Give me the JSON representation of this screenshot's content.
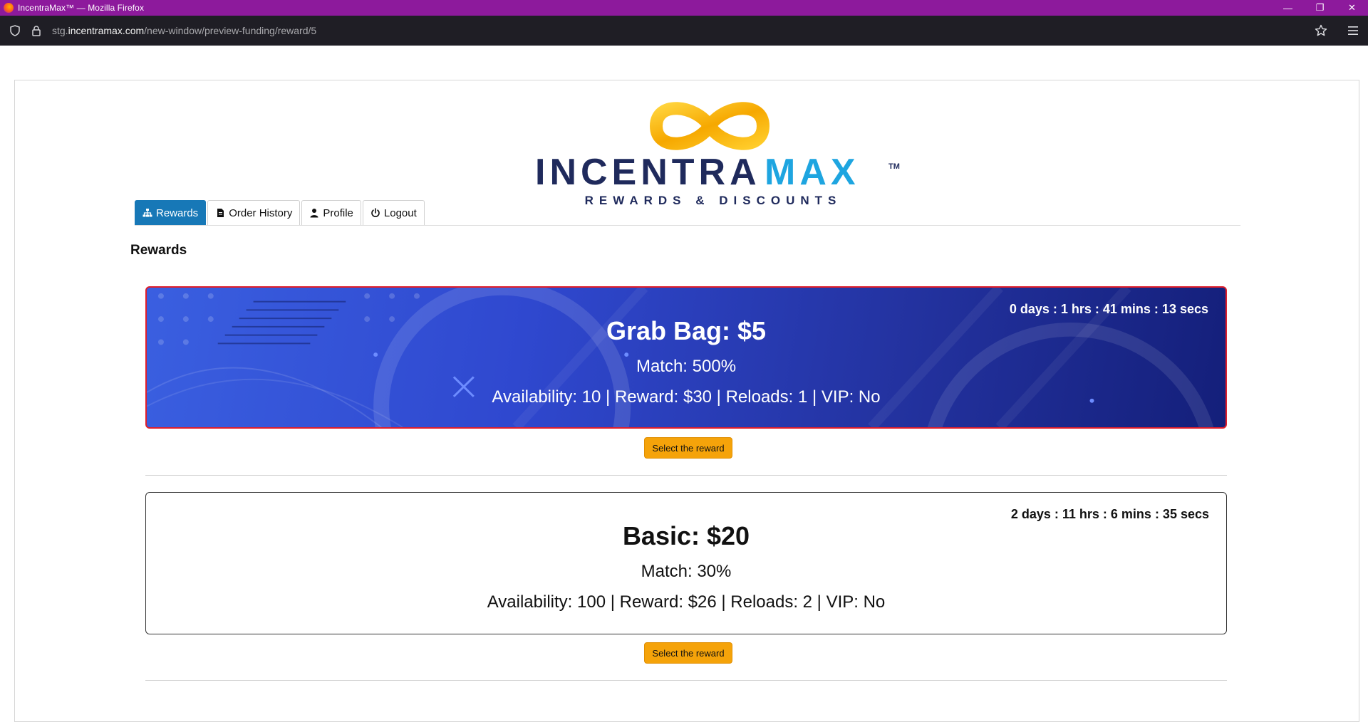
{
  "browser": {
    "window_title": "IncentraMax™ — Mozilla Firefox",
    "url_prefix": "stg.",
    "url_domain": "incentramax.com",
    "url_path": "/new-window/preview-funding/reward/5"
  },
  "logo": {
    "brand_text_dark": "INCENTRA",
    "brand_text_accent": "MAX",
    "trademark": "TM",
    "tagline": "REWARDS & DISCOUNTS"
  },
  "nav": {
    "tabs": [
      {
        "label": "Rewards",
        "icon": "sitemap-icon",
        "active": true
      },
      {
        "label": "Order History",
        "icon": "document-icon",
        "active": false
      },
      {
        "label": "Profile",
        "icon": "user-icon",
        "active": false
      },
      {
        "label": "Logout",
        "icon": "power-icon",
        "active": false
      }
    ]
  },
  "section_title": "Rewards",
  "rewards": [
    {
      "timer": "0 days : 1 hrs : 41 mins : 13 secs",
      "name": "Grab Bag: $5",
      "match": "Match: 500%",
      "details": "Availability: 10 | Reward: $30 | Reloads: 1 | VIP: No",
      "button_label": "Select the reward"
    },
    {
      "timer": "2 days : 11 hrs : 6 mins : 35 secs",
      "name": "Basic: $20",
      "match": "Match: 30%",
      "details": "Availability: 100 | Reward: $26 | Reloads: 2 | VIP: No",
      "button_label": "Select the reward"
    }
  ],
  "colors": {
    "titlebar": "#8d1a9c",
    "active_tab": "#1778b7",
    "select_button": "#f5a30a",
    "featured_border": "#e01e2a",
    "logo_navy": "#1f2a5c",
    "logo_cyan": "#1ea5e0",
    "logo_gold": "#f6b40a"
  }
}
